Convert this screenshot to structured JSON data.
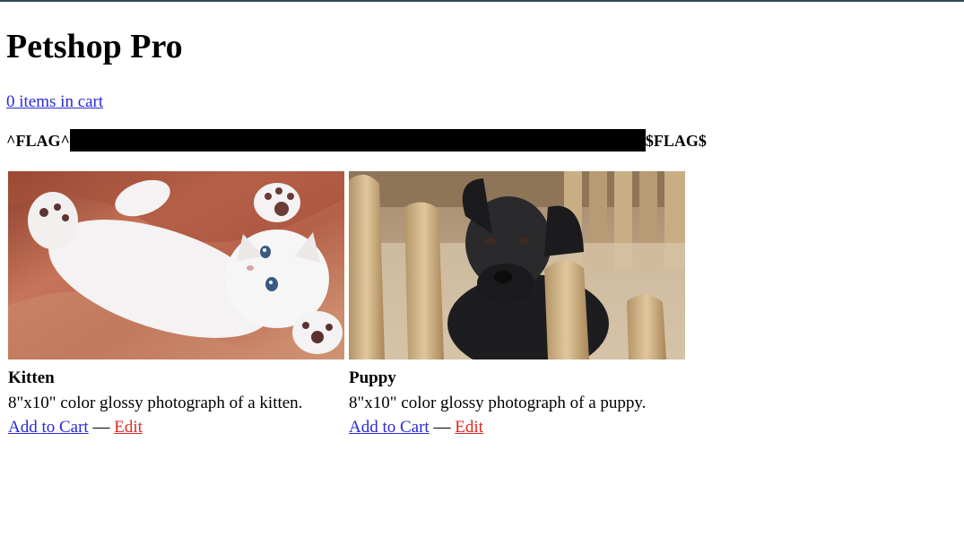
{
  "page": {
    "title": "Petshop Pro",
    "cart_link": "0 items in cart",
    "flag_prefix": "^FLAG^",
    "flag_suffix": "$FLAG$"
  },
  "products": [
    {
      "name": "Kitten",
      "description": "8\"x10\" color glossy photograph of a kitten.",
      "add_label": "Add to Cart",
      "separator": "—",
      "edit_label": "Edit"
    },
    {
      "name": "Puppy",
      "description": "8\"x10\" color glossy photograph of a puppy.",
      "add_label": "Add to Cart",
      "separator": "—",
      "edit_label": "Edit"
    }
  ],
  "colors": {
    "link": "#2a2ad6",
    "edit_link": "#e0281f",
    "top_rule": "#2c4a54"
  }
}
